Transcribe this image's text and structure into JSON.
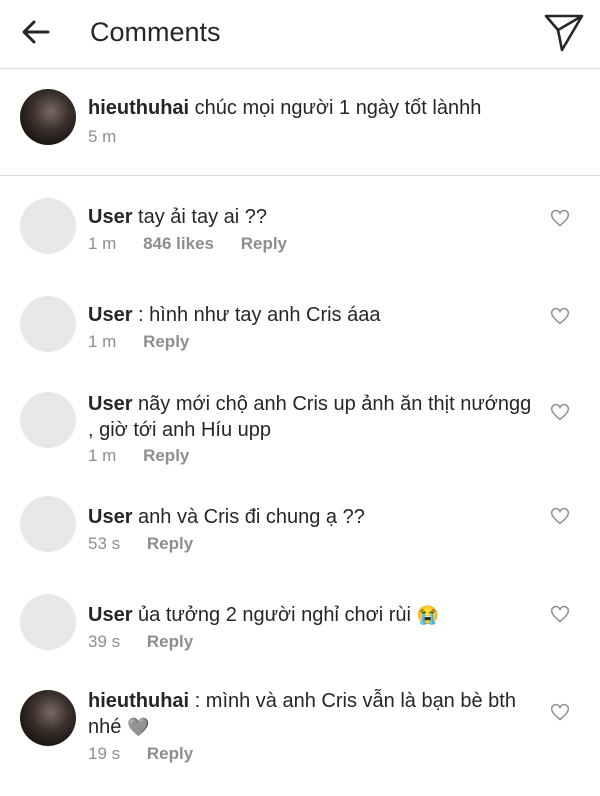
{
  "header": {
    "title": "Comments"
  },
  "caption": {
    "username": "hieuthuhai",
    "text": "chúc mọi người 1 ngày tốt lànhh",
    "time": "5 m"
  },
  "comments": [
    {
      "username": "User",
      "text": "tay ải tay ai ??",
      "time": "1 m",
      "likes": "846 likes",
      "reply": "Reply"
    },
    {
      "username": "User",
      "text": ": hình như tay anh Cris áaa",
      "time": "1 m",
      "reply": "Reply"
    },
    {
      "username": "User",
      "text": "nãy mới chộ anh Cris up ảnh ăn thịt nướngg , giờ tới anh Híu upp",
      "time": "1 m",
      "reply": "Reply"
    },
    {
      "username": "User",
      "text": "anh và Cris đi chung ạ ??",
      "time": "53 s",
      "reply": "Reply"
    },
    {
      "username": "User",
      "text": "ủa tưởng 2 người nghỉ chơi rùi",
      "emoji": "😭",
      "time": "39 s",
      "reply": "Reply"
    },
    {
      "username": "hieuthuhai",
      "text": ": mình và anh Cris vẫn là bạn bè bth nhé",
      "emoji": "🩶",
      "time": "19 s",
      "reply": "Reply"
    }
  ]
}
